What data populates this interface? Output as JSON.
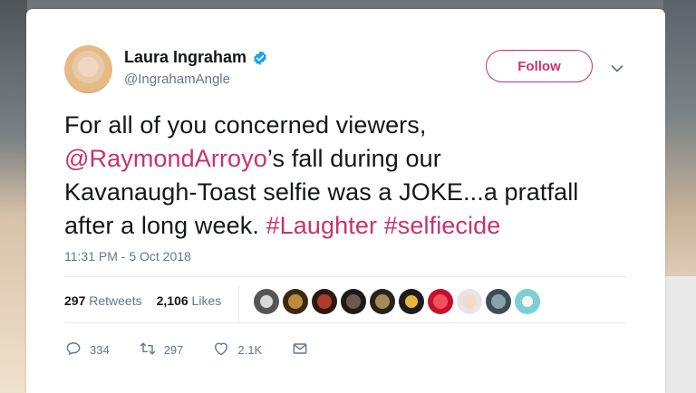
{
  "tweet": {
    "display_name": "Laura Ingraham",
    "handle": "@IngrahamAngle",
    "follow_label": "Follow",
    "text_line1": "For all of you concerned viewers,",
    "mention": "@RaymondArroyo",
    "text_line2_rest": "’s fall during our",
    "text_line3": "Kavanaugh-Toast selfie was a JOKE...a pratfall",
    "text_line4": "after a long week. ",
    "hashtag1": "#Laughter",
    "hashtag2": "#selfiecide",
    "timestamp": "11:31 PM - 5 Oct 2018"
  },
  "stats": {
    "retweets_count": "297",
    "retweets_label": "Retweets",
    "likes_count": "2,106",
    "likes_label": "Likes"
  },
  "actions": {
    "reply_count": "334",
    "retweet_count": "297",
    "like_count": "2.1K"
  },
  "colors": {
    "accent": "#c8326c",
    "verified": "#1da1f2",
    "text": "#14171a",
    "muted": "#657786"
  }
}
